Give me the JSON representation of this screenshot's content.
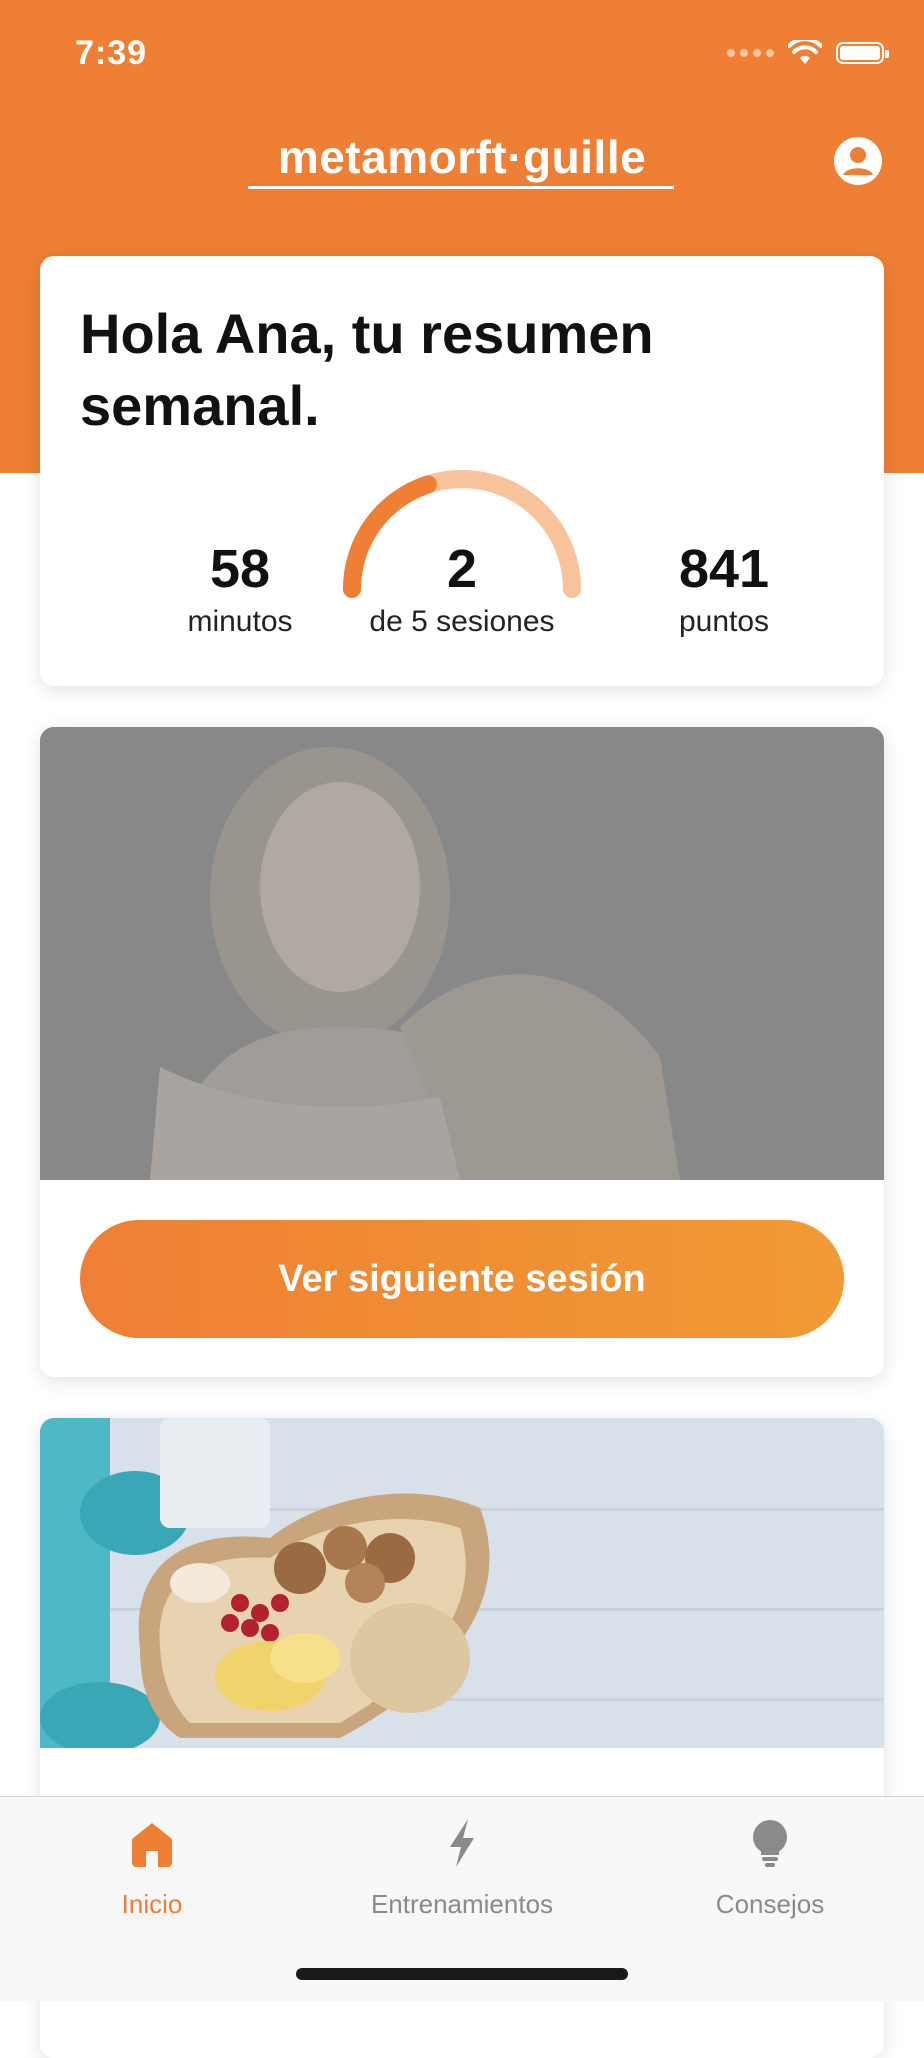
{
  "status_bar": {
    "time": "7:39"
  },
  "header": {
    "logo_text": "metamorft·guille"
  },
  "summary": {
    "title": "Hola Ana, tu resumen semanal.",
    "minutes_value": "58",
    "minutes_label": "minutos",
    "sessions_value": "2",
    "sessions_label": "de 5 sesiones",
    "sessions_progress": 0.4,
    "points_value": "841",
    "points_label": "puntos"
  },
  "hero": {
    "button_label": "Ver siguiente sesión"
  },
  "tabs": [
    {
      "label": "Inicio",
      "icon": "home-icon",
      "active": true
    },
    {
      "label": "Entrenamientos",
      "icon": "lightning-icon",
      "active": false
    },
    {
      "label": "Consejos",
      "icon": "lightbulb-icon",
      "active": false
    }
  ],
  "colors": {
    "accent": "#EF7F34",
    "accent_light": "#F8C29B",
    "tab_inactive": "#8a8a8a"
  }
}
